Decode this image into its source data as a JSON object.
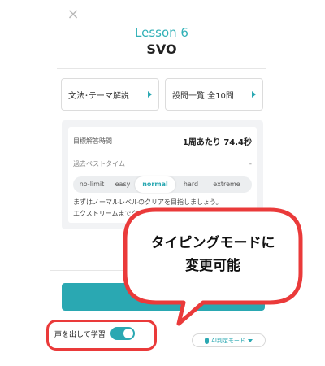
{
  "header": {
    "close_symbol": "×",
    "lesson": "Lesson 6",
    "title": "SVO"
  },
  "nav": {
    "grammar_label": "文法･テーマ解説",
    "questions_label": "設問一覧 全10問"
  },
  "info": {
    "target_time_label": "目標解答時間",
    "target_time_value": "1周あたり 74.4秒",
    "best_time_label": "過去ベストタイム",
    "best_time_value": "-",
    "difficulties": [
      "no-limit",
      "easy",
      "normal",
      "hard",
      "extreme"
    ],
    "selected_difficulty": "normal",
    "note_line1": "まずはノーマルレベルのクリアを目指しましょう。",
    "note_line2": "エクストリームまでクリアできたら完璧です。"
  },
  "footer": {
    "voice_label": "声を出して学習",
    "voice_toggle_on": true,
    "mode_label": "AI判定モード"
  },
  "callout": {
    "line1": "タイピングモードに",
    "line2": "変更可能"
  },
  "colors": {
    "accent": "#2aa8b2",
    "highlight": "#ea3a3a"
  }
}
